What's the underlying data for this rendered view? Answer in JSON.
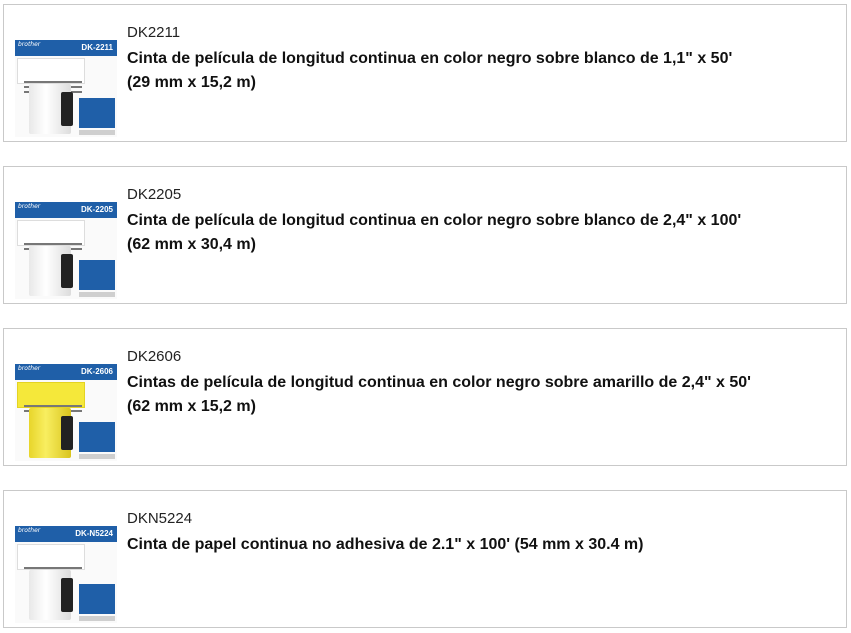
{
  "products": [
    {
      "sku": "DK2211",
      "title_line1": "Cinta de película de longitud continua en color negro sobre blanco de 1,1\" x 50'",
      "title_line2": "(29 mm x 15,2 m)",
      "thumb_model": "DK-2211",
      "thumb_brand": "brother",
      "sample_color": "white"
    },
    {
      "sku": "DK2205",
      "title_line1": "Cinta de película de longitud continua en color negro sobre blanco de 2,4\" x 100'",
      "title_line2": "(62 mm x 30,4 m)",
      "thumb_model": "DK-2205",
      "thumb_brand": "brother",
      "sample_color": "white"
    },
    {
      "sku": "DK2606",
      "title_line1": "Cintas de película de longitud continua en color negro sobre amarillo de 2,4\" x 50'",
      "title_line2": "(62 mm x 15,2 m)",
      "thumb_model": "DK-2606",
      "thumb_brand": "brother",
      "sample_color": "yellow"
    },
    {
      "sku": "DKN5224",
      "title_line1": "Cinta de papel continua no adhesiva de 2.1\" x 100' (54 mm x 30.4 m)",
      "title_line2": "",
      "thumb_model": "DK-N5224",
      "thumb_brand": "brother",
      "sample_color": "white"
    }
  ],
  "colors": {
    "border": "#c9c9c9",
    "brand_blue": "#1f5fa8",
    "label_yellow": "#f5e83a"
  }
}
